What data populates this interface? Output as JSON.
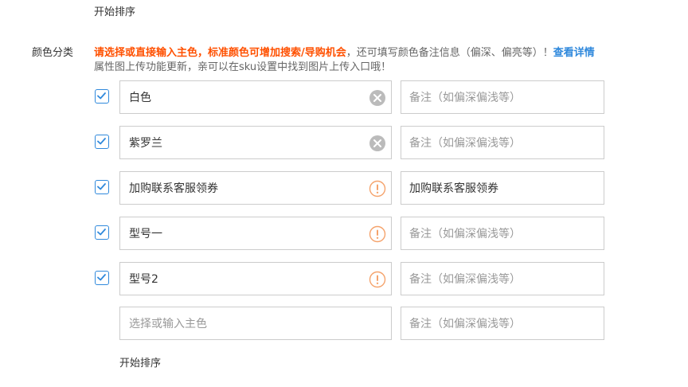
{
  "sort_top_label": "开始排序",
  "sort_bottom_label": "开始排序",
  "field_label": "颜色分类",
  "hint": {
    "bold_text": "请选择或直接输入主色，标准颜色可增加搜索/导购机会",
    "gray_text": "，还可填写颜色备注信息（偏深、偏亮等）！",
    "link_text": "查看详情",
    "line2": "属性图上传功能更新，亲可以在sku设置中找到图片上传入口哦！"
  },
  "colors": {
    "accent": "#3089dc",
    "warning": "#ff5000",
    "clear_icon": "#bbbbbb",
    "info_icon": "#f5a36c"
  },
  "rows": [
    {
      "checked": true,
      "value": "白色",
      "icon": "clear-icon",
      "note_placeholder": "备注（如偏深偏浅等）",
      "note_value": ""
    },
    {
      "checked": true,
      "value": "紫罗兰",
      "icon": "clear-icon",
      "note_placeholder": "备注（如偏深偏浅等）",
      "note_value": ""
    },
    {
      "checked": true,
      "value": "加购联系客服领券",
      "icon": "info-icon",
      "note_placeholder": "备注（如偏深偏浅等）",
      "note_value": "加购联系客服领券"
    },
    {
      "checked": true,
      "value": "型号一",
      "icon": "info-icon",
      "note_placeholder": "备注（如偏深偏浅等）",
      "note_value": ""
    },
    {
      "checked": true,
      "value": "型号2",
      "icon": "info-icon",
      "note_placeholder": "备注（如偏深偏浅等）",
      "note_value": ""
    }
  ],
  "empty_row": {
    "color_placeholder": "选择或输入主色",
    "note_placeholder": "备注（如偏深偏浅等）"
  }
}
